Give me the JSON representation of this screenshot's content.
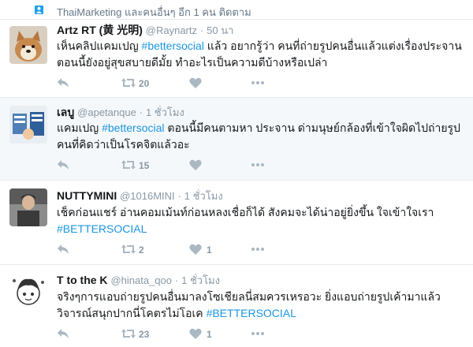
{
  "top_note": {
    "text": "ThaiMarketing และคนอื่นๆ อีก 1 คน ติดตาม"
  },
  "tweets": [
    {
      "name": "Artz RT (黄 光明)",
      "handle": "@Raynartz",
      "sep": "·",
      "time": "50 นา",
      "text_before": "เห็นคลิปแคมเปญ ",
      "hashtag": "#bettersocial",
      "text_after": " แล้ว อยากรู้ว่า คนที่ถ่ายรูปคนอื่นแล้วแต่งเรื่องประจาน ตอนนี้ยังอยู่สุขสบายดีมั้ย ทำอะไรเป็นความดีบ้างหรือเปล่า",
      "retweets": "20",
      "likes": ""
    },
    {
      "name": "เลบู",
      "handle": "@apetanque",
      "sep": "·",
      "time": "1 ชั่วโมง",
      "text_before": "แคมเปญ ",
      "hashtag": "#bettersocial",
      "text_after": " ตอนนี้มีคนตามหา ประจาน ด่ามนุษย์กล้องที่เข้าใจผิดไปถ่ายรูปคนที่คิดว่าเป็นโรคจิตแล้วอะ",
      "retweets": "15",
      "likes": ""
    },
    {
      "name": "NUTTYMINI",
      "handle": "@1016MINI",
      "sep": "·",
      "time": "1 ชั่วโมง",
      "text_before": "เช็คก่อนแชร์ อ่านคอมเม้นท์ก่อนหลงเชื่อก็ได้ สังคมจะได้น่าอยู่ยิ่งขึ้น ใจเข้าใจเรา",
      "hashtag": "#BETTERSOCIAL",
      "text_after": "",
      "retweets": "2",
      "likes": "1"
    },
    {
      "name": "T to the K",
      "handle": "@hinata_qoo",
      "sep": "·",
      "time": "1 ชั่วโมง",
      "text_before": "จริงๆการแอบถ่ายรูปคนอื่นมาลงโซเชียลนี่สมควรเหรอวะ ยิ่งแอบถ่ายรูปเค้ามาแล้ววิจารณ์สนุกปากนี่โคตรไม่โอเค ",
      "hashtag": "#BETTERSOCIAL",
      "text_after": "",
      "retweets": "23",
      "likes": "1"
    }
  ],
  "colors": {
    "accent": "#1b95e0",
    "muted": "#8899a6",
    "highlight_bg": "#f5f8fa"
  },
  "icons": [
    "person-icon",
    "reply-icon",
    "retweet-icon",
    "heart-icon",
    "more-icon"
  ]
}
